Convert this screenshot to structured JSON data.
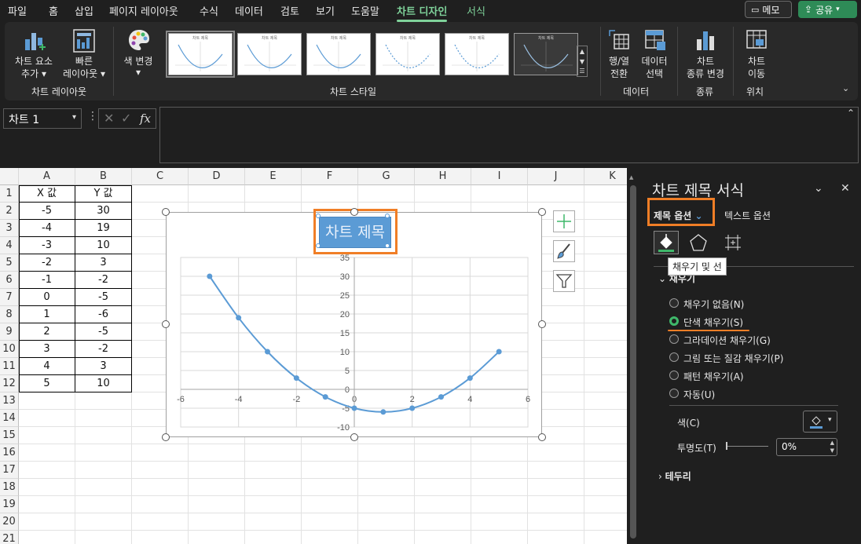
{
  "menu": {
    "items": [
      "파일",
      "홈",
      "삽입",
      "페이지 레이아웃",
      "수식",
      "데이터",
      "검토",
      "보기",
      "도움말"
    ],
    "active": "차트 디자인",
    "context": "서식",
    "memo": "메모",
    "share": "공유"
  },
  "ribbon": {
    "add_element": [
      "차트 요소",
      "추가"
    ],
    "quick_layout": [
      "빠른",
      "레이아웃"
    ],
    "group_layout": "차트 레이아웃",
    "change_color": "색 변경",
    "group_styles": "차트 스타일",
    "style_thumb_titles": [
      "차트 제목",
      "차트 제목",
      "차트 제목",
      "차트 제목",
      "차트 제목",
      "차트 제목"
    ],
    "switch_row_col": [
      "행/열",
      "전환"
    ],
    "select_data": [
      "데이터",
      "선택"
    ],
    "group_data": "데이터",
    "change_type": [
      "차트",
      "종류 변경"
    ],
    "group_type": "종류",
    "move_chart": [
      "차트",
      "이동"
    ],
    "group_location": "위치"
  },
  "formula": {
    "name_box": "차트 1",
    "fx": "fx",
    "value": ""
  },
  "sheet": {
    "columns": [
      "A",
      "B",
      "C",
      "D",
      "E",
      "F",
      "G",
      "H",
      "I",
      "J",
      "K"
    ],
    "rows": [
      "1",
      "2",
      "3",
      "4",
      "5",
      "6",
      "7",
      "8",
      "9",
      "10",
      "11",
      "12",
      "13",
      "14",
      "15",
      "16",
      "17",
      "18",
      "19",
      "20",
      "21"
    ],
    "headers": [
      "X 값",
      "Y 값"
    ],
    "data": [
      [
        "-5",
        "30"
      ],
      [
        "-4",
        "19"
      ],
      [
        "-3",
        "10"
      ],
      [
        "-2",
        "3"
      ],
      [
        "-1",
        "-2"
      ],
      [
        "0",
        "-5"
      ],
      [
        "1",
        "-6"
      ],
      [
        "2",
        "-5"
      ],
      [
        "3",
        "-2"
      ],
      [
        "4",
        "3"
      ],
      [
        "5",
        "10"
      ]
    ]
  },
  "chart_data": {
    "type": "scatter",
    "title": "차트 제목",
    "x": [
      -5,
      -4,
      -3,
      -2,
      -1,
      0,
      1,
      2,
      3,
      4,
      5
    ],
    "y": [
      30,
      19,
      10,
      3,
      -2,
      -5,
      -6,
      -5,
      -2,
      3,
      10
    ],
    "xlim": [
      -6,
      6
    ],
    "ylim": [
      -10,
      35
    ],
    "x_ticks": [
      "-6",
      "-4",
      "-2",
      "0",
      "2",
      "4",
      "6"
    ],
    "y_ticks": [
      "-10",
      "-5",
      "0",
      "5",
      "10",
      "15",
      "20",
      "25",
      "30",
      "35"
    ],
    "grid": true,
    "smooth": true,
    "color": "#5b9bd5"
  },
  "pane": {
    "title": "차트 제목 서식",
    "tab_title_options": "제목 옵션",
    "tab_text_options": "텍스트 옵션",
    "tooltip": "채우기 및 선",
    "fill_section": "채우기",
    "fill_options": [
      "채우기 없음(N)",
      "단색 채우기(S)",
      "그라데이션 채우기(G)",
      "그림 또는 질감 채우기(P)",
      "패턴 채우기(A)",
      "자동(U)"
    ],
    "selected_fill": "단색 채우기(S)",
    "color_label": "색(C)",
    "transparency_label": "투명도(T)",
    "transparency_value": "0%",
    "border_section": "테두리"
  },
  "colors": {
    "accent": "#7fd29a",
    "highlight": "#f07e26",
    "share": "#2e8b57"
  }
}
